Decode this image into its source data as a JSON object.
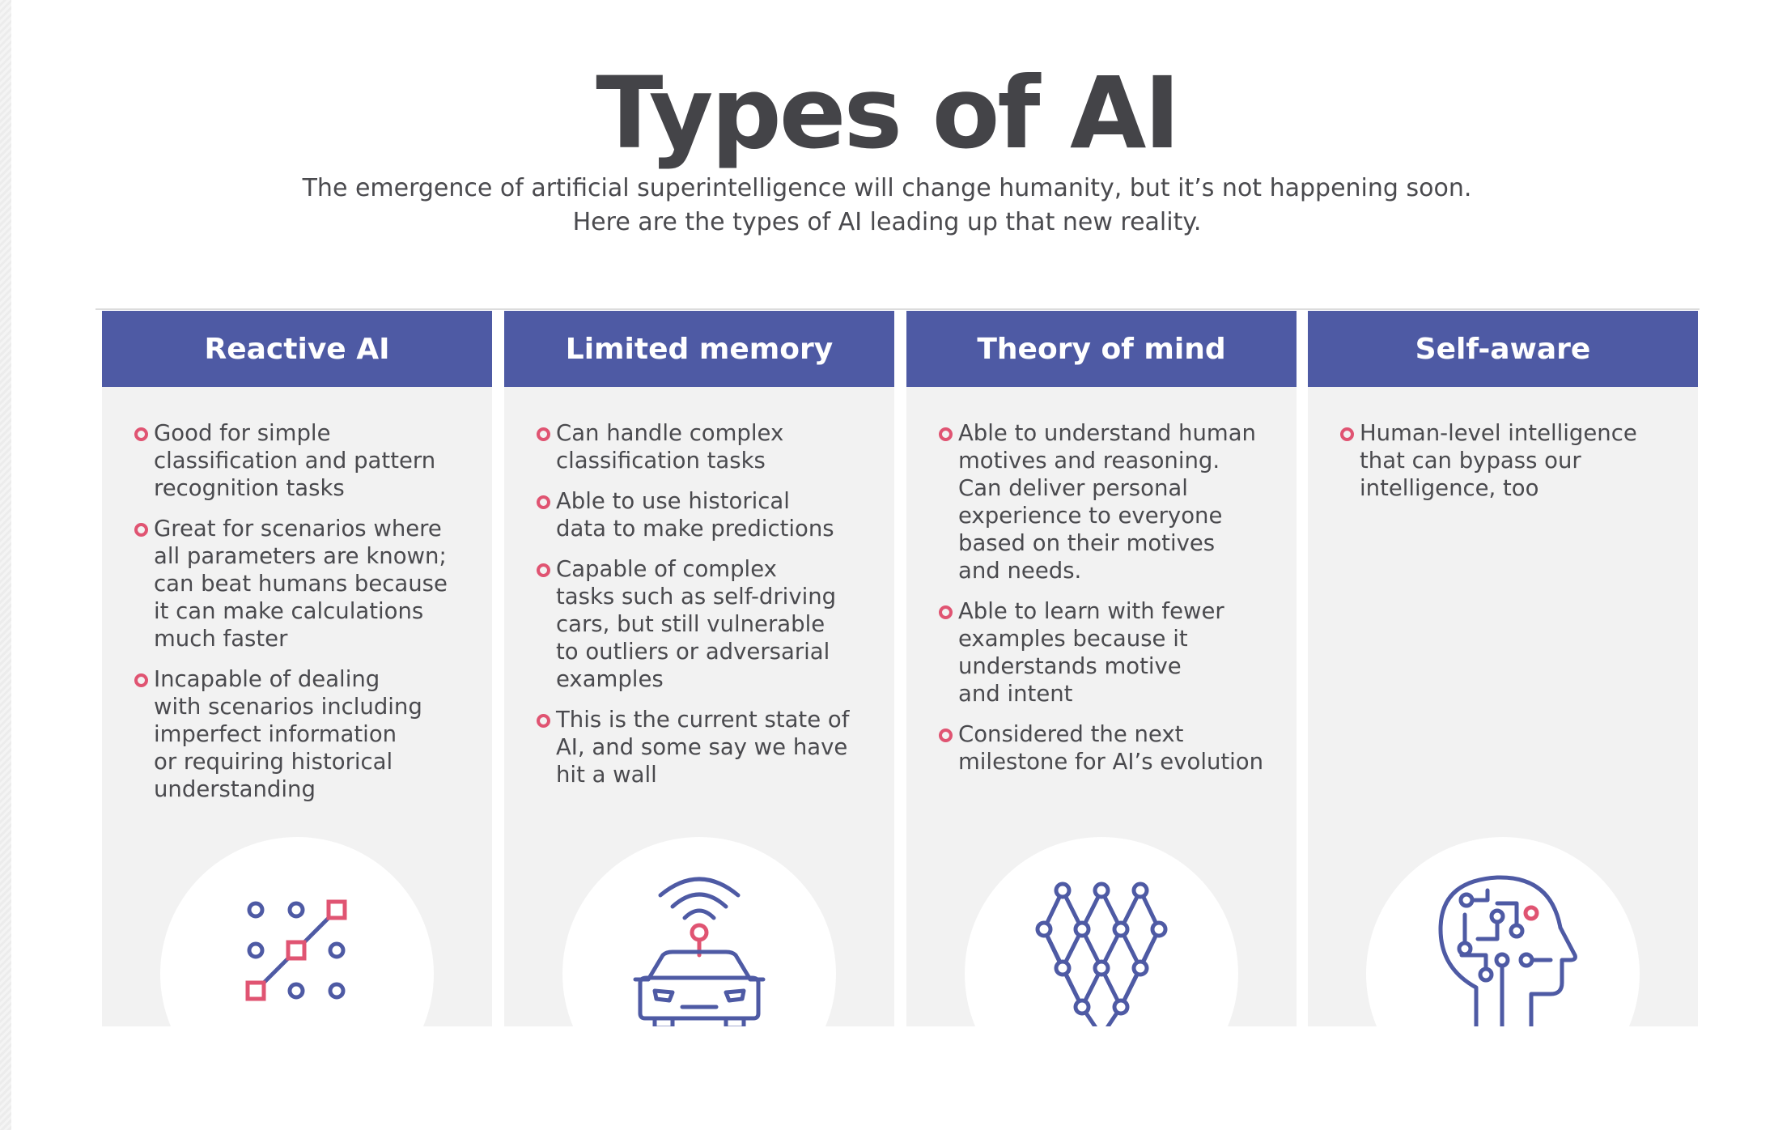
{
  "title": "Types of AI",
  "subtitle": {
    "line1": "The emergence of artificial superintelligence will change humanity, but it’s not happening soon.",
    "line2": "Here are the types of AI leading up that new reality."
  },
  "colors": {
    "header": "#4e5aa4",
    "icon_blue": "#4e5aa4",
    "accent_pink": "#e05472",
    "panel": "#f2f2f2"
  },
  "columns": [
    {
      "title": "Reactive AI",
      "icon": "dot-grid-pattern-icon",
      "bullets": [
        "Good for simple\nclassification and pattern\nrecognition tasks",
        "Great for scenarios where\nall parameters are known;\ncan beat humans because\nit can make calculations\nmuch faster",
        "Incapable of dealing\nwith scenarios including\nimperfect information\nor requiring historical\nunderstanding"
      ]
    },
    {
      "title": "Limited memory",
      "icon": "self-driving-car-icon",
      "bullets": [
        "Can handle complex\nclassification tasks",
        "Able to use historical\ndata to make predictions",
        "Capable of complex\ntasks such as self-driving\ncars, but still vulnerable\nto outliers or adversarial\nexamples",
        "This is the current state of\nAI, and some say we have\nhit a wall"
      ]
    },
    {
      "title": "Theory of mind",
      "icon": "neural-network-icon",
      "bullets": [
        "Able to understand human\nmotives and reasoning.\nCan deliver personal\nexperience to everyone\nbased on their motives\nand needs.",
        "Able to learn with fewer\nexamples because it\nunderstands motive\nand intent",
        "Considered the next\nmilestone for AI’s evolution"
      ]
    },
    {
      "title": "Self-aware",
      "icon": "circuit-head-icon",
      "bullets": [
        "Human-level intelligence\nthat can bypass our\nintelligence, too"
      ]
    }
  ]
}
